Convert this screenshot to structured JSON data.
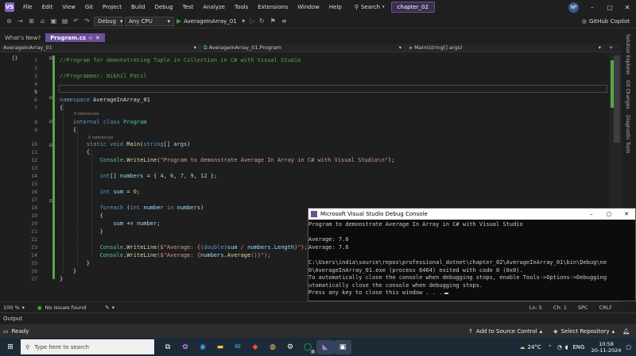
{
  "menubar": {
    "logo": "VS",
    "items": [
      "File",
      "Edit",
      "View",
      "Git",
      "Project",
      "Build",
      "Debug",
      "Test",
      "Analyze",
      "Tools",
      "Extensions",
      "Window",
      "Help"
    ],
    "search": "Search",
    "solution": "chapter_02",
    "user_initials": "NP"
  },
  "toolbar": {
    "config": "Debug",
    "platform": "Any CPU",
    "start_target": "AverageInArray_01",
    "copilot": "GitHub Copilot"
  },
  "tabs": [
    {
      "label": "What's New?",
      "active": false
    },
    {
      "label": "Program.cs",
      "active": true
    }
  ],
  "navbar": {
    "project": "AverageInArray_01",
    "class": "AverageInArray_01.Program",
    "member": "Main(string[] args)"
  },
  "code": {
    "lines": [
      {
        "n": "1",
        "t": [
          [
            "//Program for demonstrating Tuple in Collection in C# with Visual Studio",
            "com"
          ]
        ]
      },
      {
        "n": "2",
        "t": []
      },
      {
        "n": "3",
        "t": [
          [
            "//Programmer: Nikhil Patil",
            "com"
          ]
        ]
      },
      {
        "n": "4",
        "t": []
      },
      {
        "n": "5",
        "t": []
      },
      {
        "n": "6",
        "t": [
          [
            "namespace ",
            "kw"
          ],
          [
            "AverageInArray_01",
            "pun"
          ]
        ]
      },
      {
        "n": "7",
        "t": [
          [
            "{",
            "pun"
          ]
        ]
      },
      {
        "n": "8",
        "t": [
          [
            "    internal class ",
            "kw"
          ],
          [
            "Program",
            "type"
          ]
        ]
      },
      {
        "n": "9",
        "t": [
          [
            "    {",
            "pun"
          ]
        ]
      },
      {
        "n": "10",
        "t": [
          [
            "        static void ",
            "kw"
          ],
          [
            "Main",
            "meth"
          ],
          [
            "(",
            "pun"
          ],
          [
            "string",
            "kw"
          ],
          [
            "[] ",
            "pun"
          ],
          [
            "args",
            "var"
          ],
          [
            ")",
            "pun"
          ]
        ]
      },
      {
        "n": "11",
        "t": [
          [
            "        {",
            "pun"
          ]
        ]
      },
      {
        "n": "12",
        "t": [
          [
            "            ",
            "pun"
          ],
          [
            "Console",
            "type"
          ],
          [
            ".",
            "pun"
          ],
          [
            "WriteLine",
            "meth"
          ],
          [
            "(",
            "pun"
          ],
          [
            "\"Program to demonstrate Average In Array in C# with Visual Studio\\n\"",
            "str"
          ],
          [
            ");",
            "pun"
          ]
        ]
      },
      {
        "n": "13",
        "t": []
      },
      {
        "n": "14",
        "t": [
          [
            "            ",
            "pun"
          ],
          [
            "int",
            "kw"
          ],
          [
            "[] ",
            "pun"
          ],
          [
            "numbers",
            "var"
          ],
          [
            " = { ",
            "pun"
          ],
          [
            "4",
            "num"
          ],
          [
            ", ",
            "pun"
          ],
          [
            "6",
            "num"
          ],
          [
            ", ",
            "pun"
          ],
          [
            "7",
            "num"
          ],
          [
            ", ",
            "pun"
          ],
          [
            "9",
            "num"
          ],
          [
            ", ",
            "pun"
          ],
          [
            "12",
            "num"
          ],
          [
            " };",
            "pun"
          ]
        ]
      },
      {
        "n": "15",
        "t": []
      },
      {
        "n": "16",
        "t": [
          [
            "            ",
            "pun"
          ],
          [
            "int ",
            "kw"
          ],
          [
            "sum",
            "var"
          ],
          [
            " = ",
            "pun"
          ],
          [
            "0",
            "num"
          ],
          [
            ";",
            "pun"
          ]
        ]
      },
      {
        "n": "17",
        "t": []
      },
      {
        "n": "18",
        "t": [
          [
            "            ",
            "pun"
          ],
          [
            "foreach ",
            "kw"
          ],
          [
            "(",
            "pun"
          ],
          [
            "int ",
            "kw"
          ],
          [
            "number ",
            "var"
          ],
          [
            "in ",
            "kw"
          ],
          [
            "numbers",
            "var"
          ],
          [
            ")",
            "pun"
          ]
        ]
      },
      {
        "n": "19",
        "t": [
          [
            "            {",
            "pun"
          ]
        ]
      },
      {
        "n": "20",
        "t": [
          [
            "                ",
            "pun"
          ],
          [
            "sum",
            "var"
          ],
          [
            " += ",
            "pun"
          ],
          [
            "number",
            "var"
          ],
          [
            ";",
            "pun"
          ]
        ]
      },
      {
        "n": "21",
        "t": [
          [
            "            }",
            "pun"
          ]
        ]
      },
      {
        "n": "22",
        "t": []
      },
      {
        "n": "23",
        "t": [
          [
            "            ",
            "pun"
          ],
          [
            "Console",
            "type"
          ],
          [
            ".",
            "pun"
          ],
          [
            "WriteLine",
            "meth"
          ],
          [
            "($\"Average: {(",
            "str"
          ],
          [
            "double",
            "kw"
          ],
          [
            ")",
            "str"
          ],
          [
            "sum",
            "var"
          ],
          [
            " / ",
            "str"
          ],
          [
            "numbers",
            "var"
          ],
          [
            ".",
            "str"
          ],
          [
            "Length",
            "var"
          ],
          [
            "}\");",
            "str"
          ]
        ]
      },
      {
        "n": "24",
        "t": [
          [
            "            ",
            "pun"
          ],
          [
            "Console",
            "type"
          ],
          [
            ".",
            "pun"
          ],
          [
            "WriteLine",
            "meth"
          ],
          [
            "($\"Average: {",
            "str"
          ],
          [
            "numbers",
            "var"
          ],
          [
            ".",
            "pun"
          ],
          [
            "Average",
            "meth"
          ],
          [
            "()}\");",
            "str"
          ]
        ]
      },
      {
        "n": "25",
        "t": [
          [
            "        }",
            "pun"
          ]
        ]
      },
      {
        "n": "26",
        "t": [
          [
            "    }",
            "pun"
          ]
        ]
      },
      {
        "n": "27",
        "t": [
          [
            "}",
            "pun"
          ]
        ]
      }
    ],
    "references_label": "0 references"
  },
  "editor_status": {
    "zoom": "100 %",
    "issues": "No issues found",
    "ln": "Ln: 5",
    "ch": "Ch: 1",
    "spc": "SPC",
    "eol": "CRLF"
  },
  "output_label": "Output",
  "statusbar": {
    "ready": "Ready",
    "add_source": "Add to Source Control",
    "select_repo": "Select Repository"
  },
  "right_panel": [
    "Solution Explorer",
    "Git Changes",
    "Diagnostic Tools"
  ],
  "console": {
    "title": "Microsoft Visual Studio Debug Console",
    "lines": [
      "Program to demonstrate Average In Array in C# with Visual Studio",
      "",
      "Average: 7.6",
      "Average: 7.6",
      "",
      "C:\\Users\\india\\source\\repos\\professional_dotnet\\chapter_02\\AverageInArray_01\\bin\\Debug\\ne",
      "0\\AverageInArray_01.exe (process 6464) exited with code 0 (0x0).",
      "To automatically close the console when debugging stops, enable Tools->Options->Debugging",
      "utomatically close the console when debugging stops.",
      "Press any key to close this window . . ."
    ]
  },
  "taskbar": {
    "search_placeholder": "Type here to search",
    "weather": "24°C",
    "lang": "ENG",
    "time": "10:58",
    "date": "20-11-2024",
    "whatsapp_badge": "9"
  }
}
